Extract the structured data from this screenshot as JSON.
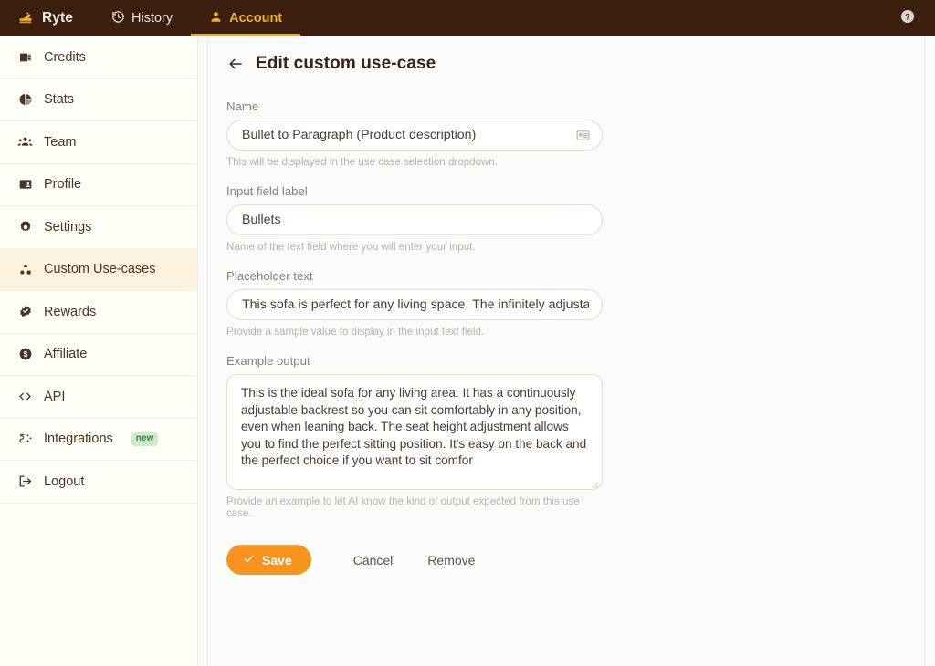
{
  "topbar": {
    "brand": "Ryte",
    "brand_icon": "writing-hand-icon",
    "tabs": [
      {
        "label": "History",
        "icon": "history-clock-icon",
        "active": false
      },
      {
        "label": "Account",
        "icon": "user-person-icon",
        "active": true
      }
    ],
    "help_icon": "question-mark-help-icon",
    "active_underline_color": "#f5a623",
    "background_color": "#3b1f0e"
  },
  "sidebar": {
    "items": [
      {
        "label": "Credits",
        "icon": "credit-card-icon",
        "active": false,
        "badge": ""
      },
      {
        "label": "Stats",
        "icon": "pie-chart-icon",
        "active": false,
        "badge": ""
      },
      {
        "label": "Team",
        "icon": "people-group-icon",
        "active": false,
        "badge": ""
      },
      {
        "label": "Profile",
        "icon": "id-card-icon",
        "active": false,
        "badge": ""
      },
      {
        "label": "Settings",
        "icon": "gear-icon",
        "active": false,
        "badge": ""
      },
      {
        "label": "Custom Use-cases",
        "icon": "sitemap-nodes-icon",
        "active": true,
        "badge": ""
      },
      {
        "label": "Rewards",
        "icon": "rosette-check-icon",
        "active": false,
        "badge": ""
      },
      {
        "label": "Affiliate",
        "icon": "dollar-circle-icon",
        "active": false,
        "badge": ""
      },
      {
        "label": "API",
        "icon": "code-brackets-icon",
        "active": false,
        "badge": ""
      },
      {
        "label": "Integrations",
        "icon": "plug-connect-icon",
        "active": false,
        "badge": "new"
      },
      {
        "label": "Logout",
        "icon": "logout-arrow-icon",
        "active": false,
        "badge": ""
      }
    ],
    "active_background_color": "#fdf3dd",
    "badge_color": "#cdeccd"
  },
  "page": {
    "title": "Edit custom use-case",
    "back_icon": "arrow-left-icon"
  },
  "form": {
    "name": {
      "label": "Name",
      "value": "Bullet to Paragraph (Product description)",
      "placeholder": "Name",
      "hint": "This will be displayed in the use case selection dropdown.",
      "icon": "contact-card-icon"
    },
    "input_field_label": {
      "label": "Input field label",
      "value": "Bullets",
      "placeholder": "Input field label",
      "hint": "Name of the text field where you will enter your input."
    },
    "placeholder_text": {
      "label": "Placeholder text",
      "value": "This sofa is perfect for any living space.  The infinitely adjustable",
      "placeholder": "Placeholder text",
      "hint": "Provide a sample value to display in the input text field."
    },
    "example_output": {
      "label": "Example output",
      "value": "This is the ideal sofa for any living area. It has a continuously adjustable backrest so you can sit comfortably in any position, even when leaning back. The seat height adjustment allows you to find the perfect sitting position. It's easy on the back and the perfect choice if you want to sit comfor",
      "placeholder": "Example output",
      "hint": "Provide an example to let AI know the kind of output expected from this use case."
    }
  },
  "actions": {
    "save_label": "Save",
    "save_icon": "check-icon",
    "save_color": "#f7941d",
    "cancel_label": "Cancel",
    "remove_label": "Remove"
  }
}
